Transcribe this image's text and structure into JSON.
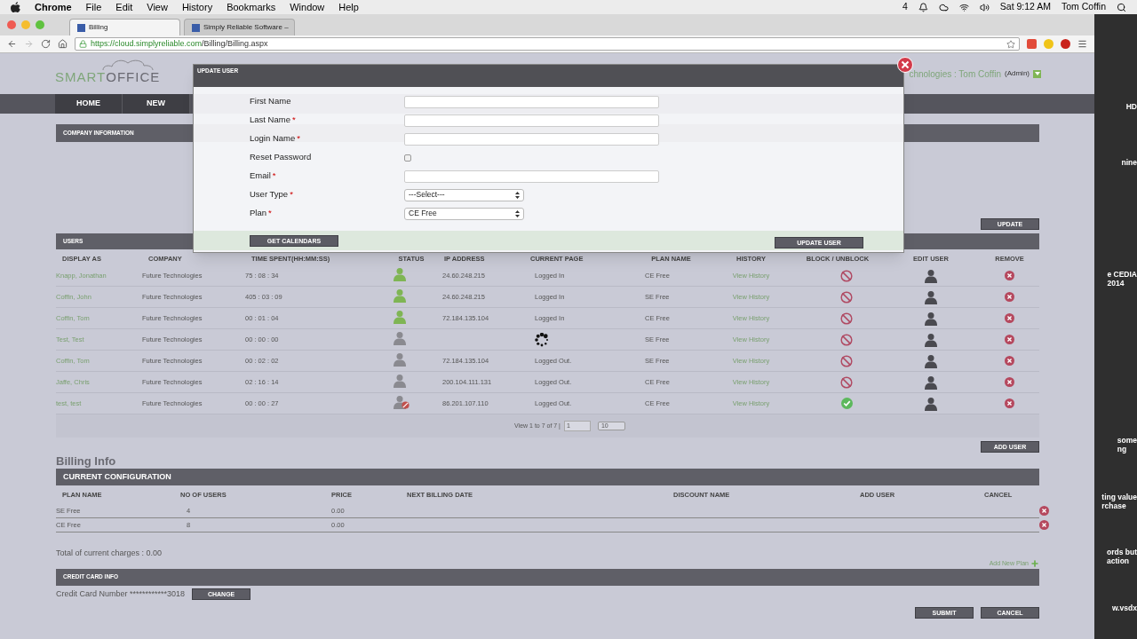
{
  "menubar": {
    "app": "Chrome",
    "menus": [
      "File",
      "Edit",
      "View",
      "History",
      "Bookmarks",
      "Window",
      "Help"
    ],
    "badge": "4",
    "clock": "Sat 9:12 AM",
    "user": "Tom Coffin"
  },
  "tabs": [
    {
      "label": "Billing",
      "selected": true
    },
    {
      "label": "Simply Reliable Software –",
      "selected": false
    }
  ],
  "address": {
    "host": "https://cloud.simplyreliable.com",
    "path": "/Billing/Billing.aspx"
  },
  "logo": {
    "part_1": "SMART",
    "part_2": "OFFICE"
  },
  "header_user": {
    "name": "chnologies : Tom Coffin",
    "role": "(Admin)"
  },
  "nav": [
    {
      "label": "HOME"
    },
    {
      "label": "NEW"
    }
  ],
  "company_section": {
    "title": "COMPANY INFORMATION",
    "button": "UPDATE"
  },
  "modal": {
    "title": "UPDATE USER",
    "fields": [
      {
        "kind": "text",
        "label": "First Name",
        "required": false
      },
      {
        "kind": "text",
        "label": "Last Name",
        "required": true
      },
      {
        "kind": "text",
        "label": "Login Name",
        "required": true
      },
      {
        "kind": "checkbox",
        "label": "Reset Password",
        "required": false,
        "checked": false
      },
      {
        "kind": "text",
        "label": "Email",
        "required": true
      },
      {
        "kind": "select",
        "label": "User Type",
        "required": true,
        "value": "---Select---"
      },
      {
        "kind": "select",
        "label": "Plan",
        "required": true,
        "value": "CE Free"
      }
    ],
    "required_mark": "*",
    "left_button": "GET CALENDARS",
    "right_button": "UPDATE USER"
  },
  "users": {
    "title": "USERS",
    "columns": [
      "DISPLAY AS",
      "COMPANY",
      "TIME SPENT(HH:MM:SS)",
      "STATUS",
      "IP ADDRESS",
      "CURRENT PAGE",
      "PLAN NAME",
      "HISTORY",
      "BLOCK / UNBLOCK",
      "EDIT USER",
      "REMOVE"
    ],
    "rows": [
      {
        "name": "Knapp, Jonathan",
        "company": "Future Technologies",
        "time": "75 : 08 : 34",
        "online": true,
        "blocked": false,
        "ip": "24.60.248.215",
        "page": "Logged In",
        "loading": false,
        "plan": "CE Free",
        "history": "View History"
      },
      {
        "name": "Coffin, John",
        "company": "Future Technologies",
        "time": "405 : 03 : 09",
        "online": true,
        "blocked": false,
        "ip": "24.60.248.215",
        "page": "Logged In",
        "loading": false,
        "plan": "SE Free",
        "history": "View History"
      },
      {
        "name": "Coffin, Tom",
        "company": "Future Technologies",
        "time": "00 : 01 : 04",
        "online": true,
        "blocked": false,
        "ip": "72.184.135.104",
        "page": "Logged In",
        "loading": false,
        "plan": "CE Free",
        "history": "View History"
      },
      {
        "name": "Test, Test",
        "company": "Future Technologies",
        "time": "00 : 00 : 00",
        "online": false,
        "blocked": false,
        "loading": true,
        "plan": "SE Free",
        "history": "View History"
      },
      {
        "name": "Coffin, Tom",
        "company": "Future Technologies",
        "time": "00 : 02 : 02",
        "online": false,
        "blocked": false,
        "ip": "72.184.135.104",
        "page": "Logged Out.",
        "loading": false,
        "plan": "SE Free",
        "history": "View History"
      },
      {
        "name": "Jaffe, Chris",
        "company": "Future Technologies",
        "time": "02 : 16 : 14",
        "online": false,
        "blocked": false,
        "ip": "200.104.111.131",
        "page": "Logged Out.",
        "loading": false,
        "plan": "CE Free",
        "history": "View History"
      },
      {
        "name": "test, test",
        "company": "Future Technologies",
        "time": "00 : 00 : 27",
        "online": false,
        "blocked": true,
        "ip": "86.201.107.110",
        "page": "Logged Out.",
        "loading": false,
        "plan": "CE Free",
        "history": "View History"
      }
    ],
    "pager": {
      "text": "View 1 to 7 of 7 |",
      "page": "1",
      "per_page": "10"
    },
    "button": "ADD USER"
  },
  "billing": {
    "title": "Billing Info",
    "config_title": "CURRENT CONFIGURATION",
    "columns": [
      "PLAN NAME",
      "NO OF USERS",
      "PRICE",
      "NEXT BILLING DATE",
      "DISCOUNT NAME",
      "ADD USER",
      "CANCEL"
    ],
    "rows": [
      {
        "plan": "SE Free",
        "users": "4",
        "price": "0.00"
      },
      {
        "plan": "CE Free",
        "users": "8",
        "price": "0.00"
      }
    ],
    "total": "Total of current charges : 0.00",
    "add_plan": "Add New Plan"
  },
  "credit": {
    "title": "CREDIT CARD INFO",
    "number": "Credit Card Number ************3018",
    "button": "CHANGE"
  },
  "actions": [
    "SUBMIT",
    "CANCEL"
  ],
  "desktop_labels": [
    {
      "lines": [
        "HD"
      ]
    },
    {
      "lines": [
        "nine"
      ]
    },
    {
      "lines": [
        "e CEDIA",
        "2014"
      ]
    },
    {
      "lines": [
        "some",
        "ng"
      ]
    },
    {
      "lines": [
        "ting value",
        "rchase"
      ]
    },
    {
      "lines": [
        "ords but",
        "action"
      ]
    },
    {
      "lines": [
        "w.vsdx"
      ]
    }
  ]
}
